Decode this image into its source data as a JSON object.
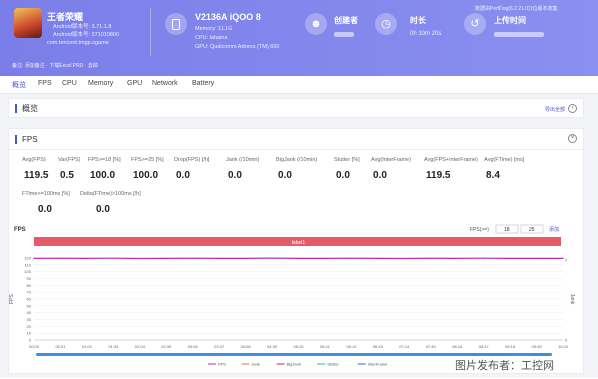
{
  "header": {
    "app_name": "王者荣耀",
    "app_version_label": "Android版本号: 3.71.1.8",
    "app_build_label": "Android版本号: 371010800",
    "app_package": "com.tencent.tmgp.sgame",
    "device_name": "V2136A iQOO 8",
    "device_memory": "Memory: 11.1G",
    "device_cpu": "CPU: lahaina",
    "device_gpu": "GPU: Qualcomm Adreno (TM) 660",
    "creator_label": "创建者",
    "duration_label": "时长",
    "duration_value": "0h 10m 20s",
    "upload_label": "上传时间",
    "top_note": "数据由PerfDog(6.2.21.0)1位版本收集",
    "notes_label": "备注",
    "notes_text": "添加备注 · 下载Excel PRD · 去掉"
  },
  "tabs": [
    "概览",
    "FPS",
    "CPU",
    "Memory",
    "GPU",
    "Network",
    "Battery"
  ],
  "overview": {
    "title": "概览",
    "link": "导出全部"
  },
  "fps_section": {
    "title": "FPS",
    "metrics": [
      {
        "label": "Avg(FPS)",
        "value": "119.5"
      },
      {
        "label": "Var(FPS)",
        "value": "0.5"
      },
      {
        "label": "FPS>=18 [%]",
        "value": "100.0"
      },
      {
        "label": "FPS>=25 [%]",
        "value": "100.0"
      },
      {
        "label": "Drop(FPS) [/h]",
        "value": "0.0"
      },
      {
        "label": "Jank (/10min)",
        "value": "0.0"
      },
      {
        "label": "BigJank (/10min)",
        "value": "0.0"
      },
      {
        "label": "Stutter [%]",
        "value": "0.0"
      },
      {
        "label": "Avg(InterFrame)",
        "value": "0.0"
      },
      {
        "label": "Avg(FPS+InterFrame)",
        "value": "119.5"
      },
      {
        "label": "Avg(FTime) [ms]",
        "value": "8.4"
      },
      {
        "label": "FTime>=100ms [%]",
        "value": "0.0"
      },
      {
        "label": "Delta(FTime)>100ms [/h]",
        "value": "0.0"
      }
    ]
  },
  "chart_controls": {
    "label": "FPS(>=)",
    "input_1": "18",
    "input_2": "25",
    "link": "添加"
  },
  "chart_data": {
    "type": "line",
    "title": "FPS",
    "label_bar": "label1",
    "ylabel": "FPS",
    "ylabel_right": "Jank",
    "ylim": [
      0,
      120
    ],
    "yticks": [
      0,
      10,
      20,
      30,
      40,
      50,
      60,
      70,
      80,
      90,
      100,
      110,
      120
    ],
    "y_right_ticks": [
      "1",
      "0"
    ],
    "xticks": [
      "00:00",
      "00:31",
      "01:02",
      "01:33",
      "02:04",
      "02:35",
      "03:06",
      "03:37",
      "04:08",
      "04:39",
      "05:10",
      "05:41",
      "06:12",
      "06:43",
      "07:14",
      "07:45",
      "08:16",
      "08:47",
      "09:18",
      "09:49",
      "10:20"
    ],
    "series": [
      {
        "name": "FPS",
        "color": "#c02bb8",
        "values": [
          119.4,
          119.6,
          119.5,
          119.7,
          119.3,
          119.5,
          119.6,
          119.4,
          119.5,
          119.8,
          119.5,
          119.4,
          119.6,
          119.5,
          119.3,
          119.6,
          119.5,
          119.7,
          119.4,
          119.5,
          119.5
        ]
      },
      {
        "name": "Jank",
        "color": "#e07b39"
      },
      {
        "name": "BigJank",
        "color": "#c0392b"
      },
      {
        "name": "Stutter",
        "color": "#2bb3a6"
      },
      {
        "name": "InterFrame",
        "color": "#3b6fd1"
      }
    ]
  },
  "watermark": "图片发布者：工控网"
}
